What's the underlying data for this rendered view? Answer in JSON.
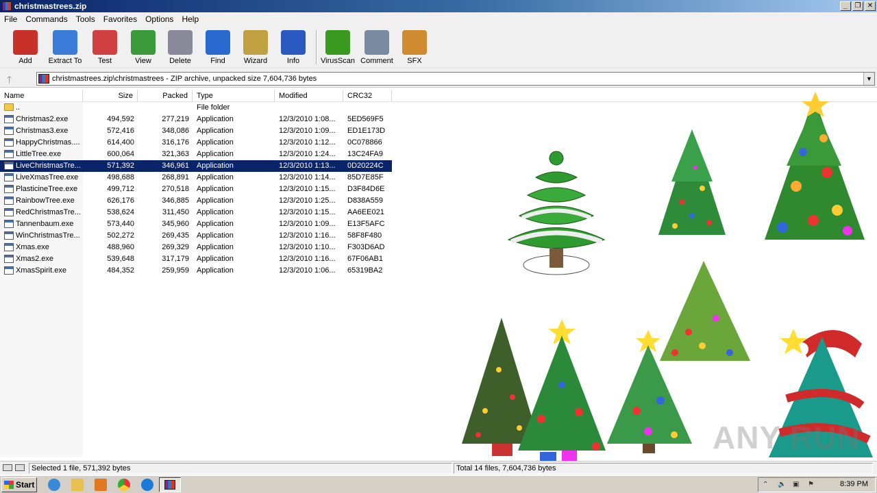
{
  "window": {
    "title": "christmastrees.zip"
  },
  "menu": [
    "File",
    "Commands",
    "Tools",
    "Favorites",
    "Options",
    "Help"
  ],
  "toolbar": [
    {
      "label": "Add",
      "icon": "add-archive-icon",
      "color": "#c8302a"
    },
    {
      "label": "Extract To",
      "icon": "extract-folder-icon",
      "color": "#3a7ad8"
    },
    {
      "label": "Test",
      "icon": "test-clipboard-icon",
      "color": "#d04040"
    },
    {
      "label": "View",
      "icon": "view-book-icon",
      "color": "#3a9a3a"
    },
    {
      "label": "Delete",
      "icon": "delete-bin-icon",
      "color": "#8a8a9a"
    },
    {
      "label": "Find",
      "icon": "find-magnifier-icon",
      "color": "#2a6ad0"
    },
    {
      "label": "Wizard",
      "icon": "wizard-wand-icon",
      "color": "#c0a040"
    },
    {
      "label": "Info",
      "icon": "info-icon",
      "color": "#2a5ac0"
    },
    {
      "label": "VirusScan",
      "icon": "virus-scan-icon",
      "color": "#3a9a20"
    },
    {
      "label": "Comment",
      "icon": "comment-icon",
      "color": "#7a8aa0"
    },
    {
      "label": "SFX",
      "icon": "sfx-box-icon",
      "color": "#d08a30"
    }
  ],
  "address": {
    "text": "christmastrees.zip\\christmastrees - ZIP archive, unpacked size 7,604,736 bytes"
  },
  "columns": [
    "Name",
    "Size",
    "Packed",
    "Type",
    "Modified",
    "CRC32"
  ],
  "files": [
    {
      "name": "..",
      "size": "",
      "packed": "",
      "type": "File folder",
      "modified": "",
      "crc": "",
      "folder": true
    },
    {
      "name": "Christmas2.exe",
      "size": "494,592",
      "packed": "277,219",
      "type": "Application",
      "modified": "12/3/2010 1:08...",
      "crc": "5ED569F5"
    },
    {
      "name": "Christmas3.exe",
      "size": "572,416",
      "packed": "348,086",
      "type": "Application",
      "modified": "12/3/2010 1:09...",
      "crc": "ED1E173D"
    },
    {
      "name": "HappyChristmas....",
      "size": "614,400",
      "packed": "316,176",
      "type": "Application",
      "modified": "12/3/2010 1:12...",
      "crc": "0C078866"
    },
    {
      "name": "LittleTree.exe",
      "size": "600,064",
      "packed": "321,363",
      "type": "Application",
      "modified": "12/3/2010 1:24...",
      "crc": "13C24FA9"
    },
    {
      "name": "LiveChristmasTre...",
      "size": "571,392",
      "packed": "346,961",
      "type": "Application",
      "modified": "12/3/2010 1:13...",
      "crc": "0D20224C",
      "selected": true
    },
    {
      "name": "LiveXmasTree.exe",
      "size": "498,688",
      "packed": "268,891",
      "type": "Application",
      "modified": "12/3/2010 1:14...",
      "crc": "85D7E85F"
    },
    {
      "name": "PlasticineTree.exe",
      "size": "499,712",
      "packed": "270,518",
      "type": "Application",
      "modified": "12/3/2010 1:15...",
      "crc": "D3F84D6E"
    },
    {
      "name": "RainbowTree.exe",
      "size": "626,176",
      "packed": "346,885",
      "type": "Application",
      "modified": "12/3/2010 1:25...",
      "crc": "D838A559"
    },
    {
      "name": "RedChristmasTre...",
      "size": "538,624",
      "packed": "311,450",
      "type": "Application",
      "modified": "12/3/2010 1:15...",
      "crc": "AA6EE021"
    },
    {
      "name": "Tannenbaum.exe",
      "size": "573,440",
      "packed": "345,960",
      "type": "Application",
      "modified": "12/3/2010 1:09...",
      "crc": "E13F5AFC"
    },
    {
      "name": "WinChristmasTre...",
      "size": "502,272",
      "packed": "269,435",
      "type": "Application",
      "modified": "12/3/2010 1:16...",
      "crc": "58F8F480"
    },
    {
      "name": "Xmas.exe",
      "size": "488,960",
      "packed": "269,329",
      "type": "Application",
      "modified": "12/3/2010 1:10...",
      "crc": "F303D6AD"
    },
    {
      "name": "Xmas2.exe",
      "size": "539,648",
      "packed": "317,179",
      "type": "Application",
      "modified": "12/3/2010 1:16...",
      "crc": "67F06AB1"
    },
    {
      "name": "XmasSpirit.exe",
      "size": "484,352",
      "packed": "259,959",
      "type": "Application",
      "modified": "12/3/2010 1:06...",
      "crc": "65319BA2"
    }
  ],
  "status": {
    "left": "Selected 1 file, 571,392 bytes",
    "right": "Total 14 files, 7,604,736 bytes"
  },
  "taskbar": {
    "start": "Start",
    "clock": "8:39 PM"
  },
  "watermark": "ANY RUN"
}
